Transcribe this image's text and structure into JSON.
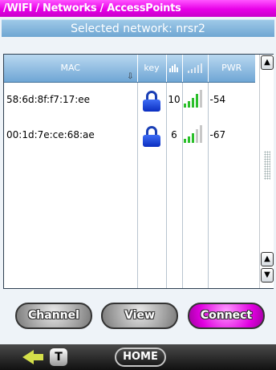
{
  "title": "/WIFI / Networks / AccessPoints",
  "subtitle": "Selected network: nrsr2",
  "table": {
    "headers": {
      "mac": "MAC",
      "key": "key",
      "pwr": "PWR"
    },
    "rows": [
      {
        "mac": "58:6d:8f:f7:17:ee",
        "channel": "10",
        "pwr": "-54",
        "signal_bars": 4
      },
      {
        "mac": "00:1d:7e:ce:68:ae",
        "channel": "6",
        "pwr": "-67",
        "signal_bars": 3
      }
    ]
  },
  "buttons": {
    "channel": "Channel",
    "view": "View",
    "connect": "Connect"
  },
  "footer": {
    "t_label": "T",
    "home": "HOME"
  },
  "colors": {
    "accent": "#e000e0",
    "header": "#6fa6d5",
    "signal_on": "#2bbf2b",
    "signal_off": "#c8c8c8",
    "lock": "#0b2ec0"
  },
  "icons": {
    "lock": "lock-icon",
    "sort": "sort-arrow-icon",
    "channel": "channel-bars-icon",
    "signal": "signal-icon",
    "back": "back-arrow-icon"
  }
}
